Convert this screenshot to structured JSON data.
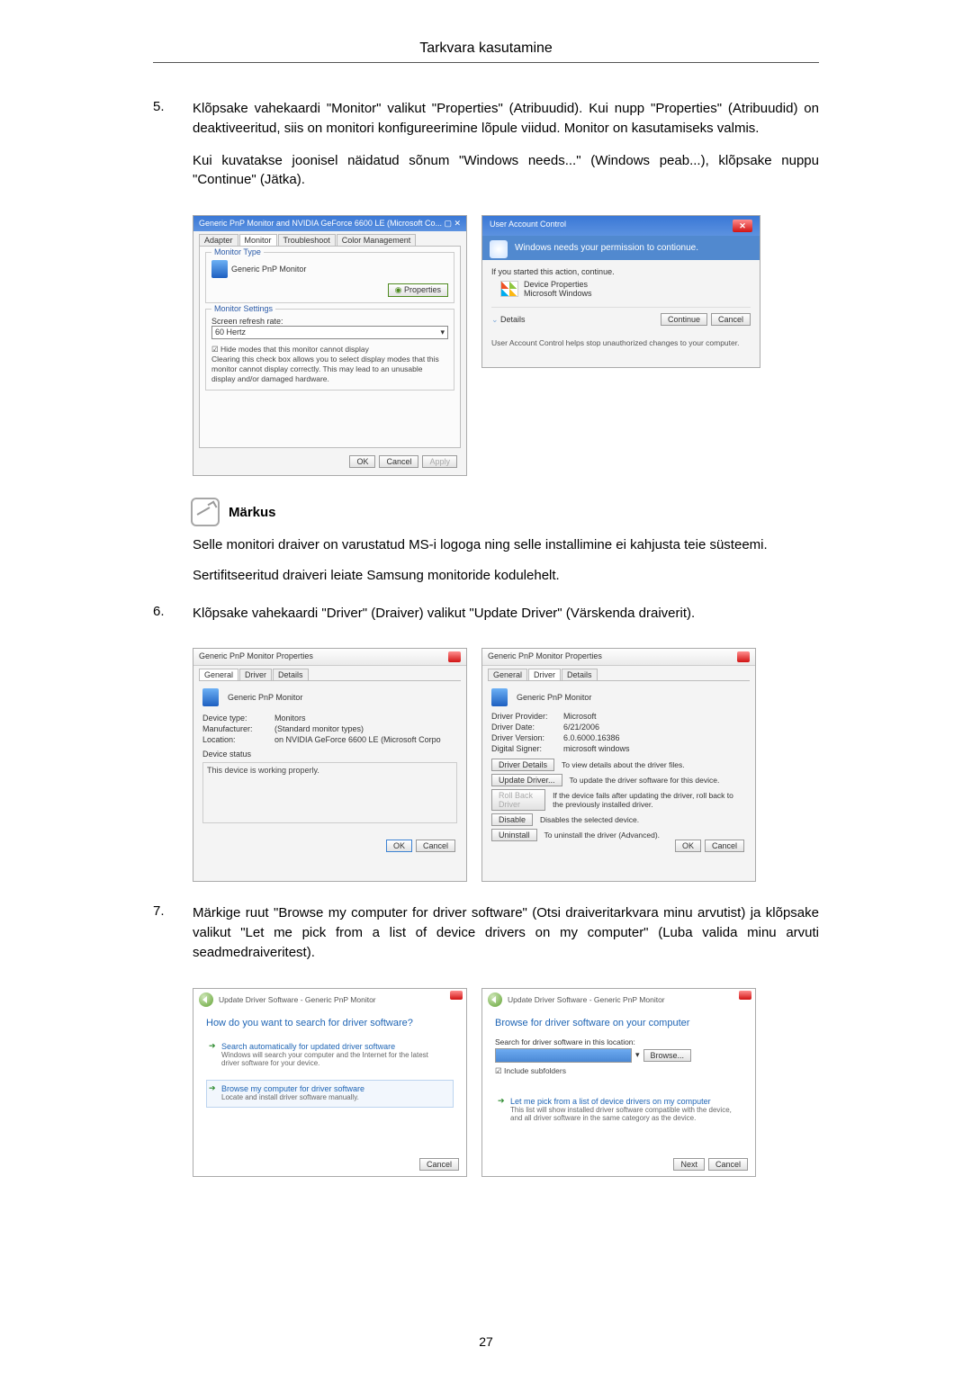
{
  "header": {
    "title": "Tarkvara kasutamine"
  },
  "step5": {
    "num": "5.",
    "p1": "Klõpsake vahekaardi \"Monitor\" valikut \"Properties\" (Atribuudid). Kui nupp \"Properties\" (Atribuudid) on deaktiveeritud, siis on monitori konfigureerimine lõpule viidud. Monitor on kasutamiseks valmis.",
    "p2": "Kui kuvatakse joonisel näidatud sõnum \"Windows needs...\" (Windows peab...), klõpsake nuppu \"Continue\" (Jätka)."
  },
  "monitor_dlg": {
    "title": "Generic PnP Monitor and NVIDIA GeForce 6600 LE (Microsoft Co...",
    "tabs": {
      "adapter": "Adapter",
      "monitor": "Monitor",
      "troubleshoot": "Troubleshoot",
      "color": "Color Management"
    },
    "grp_type": "Monitor Type",
    "type_val": "Generic PnP Monitor",
    "btn_props": "Properties",
    "grp_settings": "Monitor Settings",
    "refresh_lbl": "Screen refresh rate:",
    "refresh_val": "60 Hertz",
    "hide_ck": "Hide modes that this monitor cannot display",
    "hide_desc": "Clearing this check box allows you to select display modes that this monitor cannot display correctly. This may lead to an unusable display and/or damaged hardware.",
    "ok": "OK",
    "cancel": "Cancel",
    "apply": "Apply"
  },
  "uac": {
    "title": "User Account Control",
    "band": "Windows needs your permission to contionue.",
    "started": "If you started this action, continue.",
    "prog1": "Device Properties",
    "prog2": "Microsoft Windows",
    "details": "Details",
    "continue": "Continue",
    "cancel": "Cancel",
    "foot": "User Account Control helps stop unauthorized changes to your computer."
  },
  "note": {
    "label": "Märkus",
    "t1": "Selle monitori draiver on varustatud MS-i logoga ning selle installimine ei kahjusta teie süsteemi.",
    "t2": "Sertifitseeritud draiveri leiate Samsung monitoride kodulehelt."
  },
  "step6": {
    "num": "6.",
    "p1": "Klõpsake vahekaardi \"Driver\" (Draiver) valikut \"Update Driver\" (Värskenda draiverit)."
  },
  "prop_general": {
    "title": "Generic PnP Monitor Properties",
    "tabs": {
      "general": "General",
      "driver": "Driver",
      "details": "Details"
    },
    "head": "Generic PnP Monitor",
    "dev_type_k": "Device type:",
    "dev_type_v": "Monitors",
    "manu_k": "Manufacturer:",
    "manu_v": "(Standard monitor types)",
    "loc_k": "Location:",
    "loc_v": "on NVIDIA GeForce 6600 LE (Microsoft Corpo",
    "status_lbl": "Device status",
    "status_v": "This device is working properly.",
    "ok": "OK",
    "cancel": "Cancel"
  },
  "prop_driver": {
    "title": "Generic PnP Monitor Properties",
    "tabs": {
      "general": "General",
      "driver": "Driver",
      "details": "Details"
    },
    "head": "Generic PnP Monitor",
    "prov_k": "Driver Provider:",
    "prov_v": "Microsoft",
    "date_k": "Driver Date:",
    "date_v": "6/21/2006",
    "ver_k": "Driver Version:",
    "ver_v": "6.0.6000.16386",
    "sig_k": "Digital Signer:",
    "sig_v": "microsoft windows",
    "btn_details": "Driver Details",
    "d_details": "To view details about the driver files.",
    "btn_update": "Update Driver...",
    "d_update": "To update the driver software for this device.",
    "btn_roll": "Roll Back Driver",
    "d_roll": "If the device fails after updating the driver, roll back to the previously installed driver.",
    "btn_disable": "Disable",
    "d_disable": "Disables the selected device.",
    "btn_uninst": "Uninstall",
    "d_uninst": "To uninstall the driver (Advanced).",
    "ok": "OK",
    "cancel": "Cancel"
  },
  "step7": {
    "num": "7.",
    "p1": "Märkige ruut \"Browse my computer for driver software\" (Otsi draiveritarkvara minu arvutist) ja klõpsake valikut \"Let me pick from a list of device drivers on my computer\" (Luba valida minu arvuti seadmedraiveritest)."
  },
  "wiz1": {
    "crumb": "Update Driver Software - Generic PnP Monitor",
    "h": "How do you want to search for driver software?",
    "opt1_t": "Search automatically for updated driver software",
    "opt1_d": "Windows will search your computer and the Internet for the latest driver software for your device.",
    "opt2_t": "Browse my computer for driver software",
    "opt2_d": "Locate and install driver software manually.",
    "cancel": "Cancel"
  },
  "wiz2": {
    "crumb": "Update Driver Software - Generic PnP Monitor",
    "h": "Browse for driver software on your computer",
    "loc_lbl": "Search for driver software in this location:",
    "browse": "Browse...",
    "sub": "Include subfolders",
    "opt_t": "Let me pick from a list of device drivers on my computer",
    "opt_d": "This list will show installed driver software compatible with the device, and all driver software in the same category as the device.",
    "next": "Next",
    "cancel": "Cancel"
  },
  "page_num": "27"
}
